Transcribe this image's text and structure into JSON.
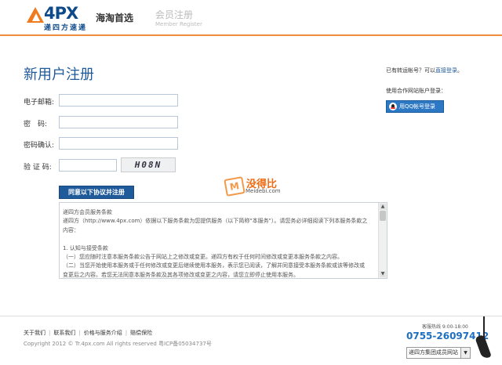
{
  "header": {
    "logo_text": "4PX",
    "logo_sub": "递四方速递",
    "slogan": "海淘首选",
    "section_title": "会员注册",
    "section_subtitle": "Member Register"
  },
  "form": {
    "title": "新用户注册",
    "email_label": "电子邮箱:",
    "password_label": "密　码:",
    "confirm_label": "密码确认:",
    "captcha_label": "验 证 码:",
    "captcha_text": "H08N",
    "submit_label": "同意以下协议并注册"
  },
  "watermark": {
    "mark": "M",
    "name": "没得比",
    "url": "Meidebi.com"
  },
  "terms": {
    "lines": [
      "递四方会员服务条款",
      "递四方（http://www.4px.com）依据以下服务条款为您提供服务（以下简称\"本服务\"）。请您务必详细阅读下列本服务条款之",
      "内容：",
      "",
      "1. 认知与接受条款",
      "（一）您应随时注意本服务条款公告于网站上之修改或变更。递四方有权于任何时间修改或变更本服务条款之内容。",
      "（二）当您开始使用本服务或于任何修改或变更后继续使用本服务，表示您已阅读，了解并同意接受本服务条款或该等修改或",
      "变更后之内容。若您无法同意本服务条款及其各项修改或变更之内容，请您立即停止使用本服务。"
    ]
  },
  "sidebar": {
    "have_account_prefix": "已有转运帐号？可以",
    "login_link": "直接登录",
    "partner_login": "使用合作网站账户登录：",
    "qq_button": "用QQ帐号登录"
  },
  "footer": {
    "links": [
      "关于我们",
      "联系我们",
      "价格与服务介绍",
      "赔偿保险"
    ],
    "copyright": "Copyright 2012 © Tr.4px.com All rights reserved 粤ICP备05034737号",
    "hotline_label": "客服热线 9:00-18:00",
    "hotline": "0755-26097412",
    "site_select": "递四方集团成员网站"
  }
}
